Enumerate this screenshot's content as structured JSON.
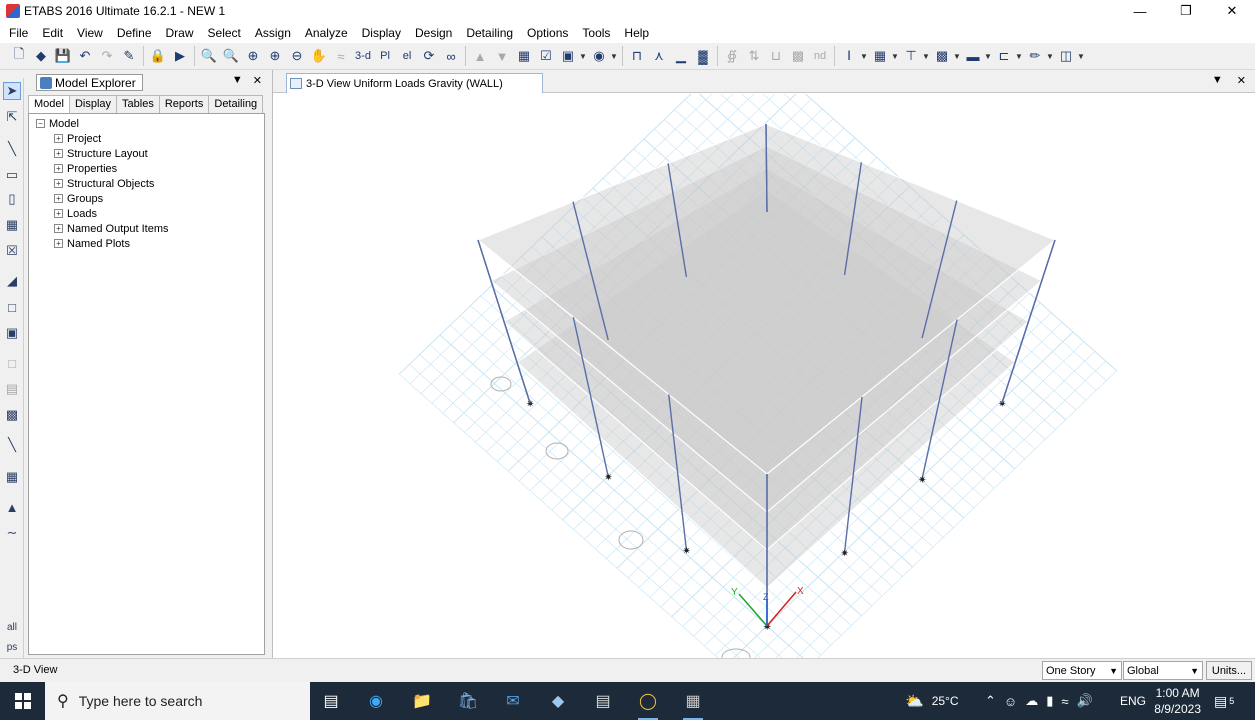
{
  "window": {
    "title": "ETABS 2016 Ultimate 16.2.1 - NEW 1",
    "minimize_icon": "minimize-icon",
    "maximize_icon": "restore-icon",
    "close_icon": "close-icon"
  },
  "menu": [
    "File",
    "Edit",
    "View",
    "Define",
    "Draw",
    "Select",
    "Assign",
    "Analyze",
    "Display",
    "Design",
    "Detailing",
    "Options",
    "Tools",
    "Help"
  ],
  "toolbar": {
    "view_3d_label": "3-d",
    "plan_label": "Pl",
    "elev_label": "el",
    "nd_label": "nd"
  },
  "explorer": {
    "title": "Model Explorer",
    "tabs": [
      "Model",
      "Display",
      "Tables",
      "Reports",
      "Detailing"
    ],
    "root": "Model",
    "items": [
      "Project",
      "Structure Layout",
      "Properties",
      "Structural Objects",
      "Groups",
      "Loads",
      "Named Output Items",
      "Named Plots"
    ]
  },
  "left_tools": {
    "all_label": "all",
    "ps_label": "ps"
  },
  "view": {
    "tab_title": "3-D View  Uniform Loads Gravity  (WALL)",
    "axis_x": "X",
    "axis_y": "Y",
    "axis_z": "Z"
  },
  "status": {
    "text": "3-D View",
    "story_select": "One Story",
    "coord_select": "Global",
    "units_button": "Units..."
  },
  "taskbar": {
    "search_placeholder": "Type here to search",
    "weather": "25°C",
    "language": "ENG",
    "time": "1:00 AM",
    "date": "8/9/2023",
    "notification_count": "5"
  },
  "colors": {
    "grid": "#c7e4f5",
    "column": "#5a6ea8",
    "slab_fill": "#c9c9c9",
    "axis_x": "#d42020",
    "axis_y": "#1fa62a",
    "axis_z": "#2060d0"
  }
}
